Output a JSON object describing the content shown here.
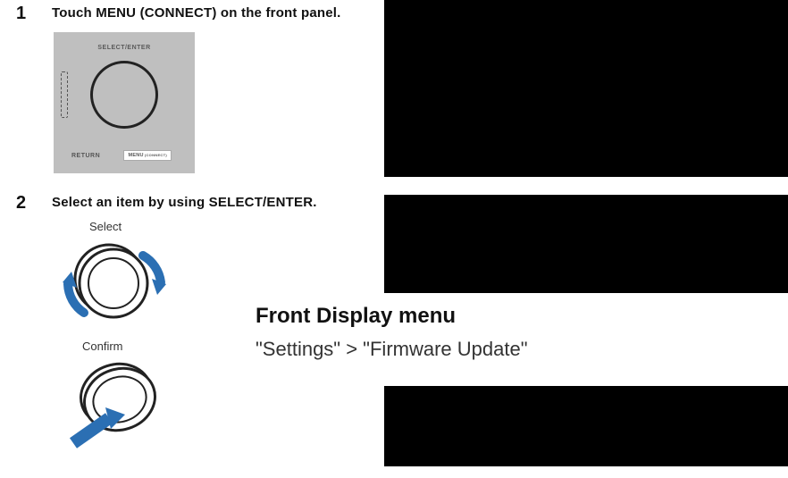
{
  "steps": {
    "s1": {
      "num": "1",
      "text": "Touch MENU (CONNECT) on the front panel.",
      "panel": {
        "top_label": "SELECT/ENTER",
        "return_label": "RETURN",
        "menu_label": "MENU",
        "menu_sub": "(CONNECT)"
      }
    },
    "s2": {
      "num": "2",
      "text": "Select an item by using SELECT/ENTER.",
      "select_label": "Select",
      "confirm_label": "Confirm"
    }
  },
  "overlay": {
    "heading": "Front Display menu",
    "path": "\"Settings\" > \"Firmware Update\""
  }
}
